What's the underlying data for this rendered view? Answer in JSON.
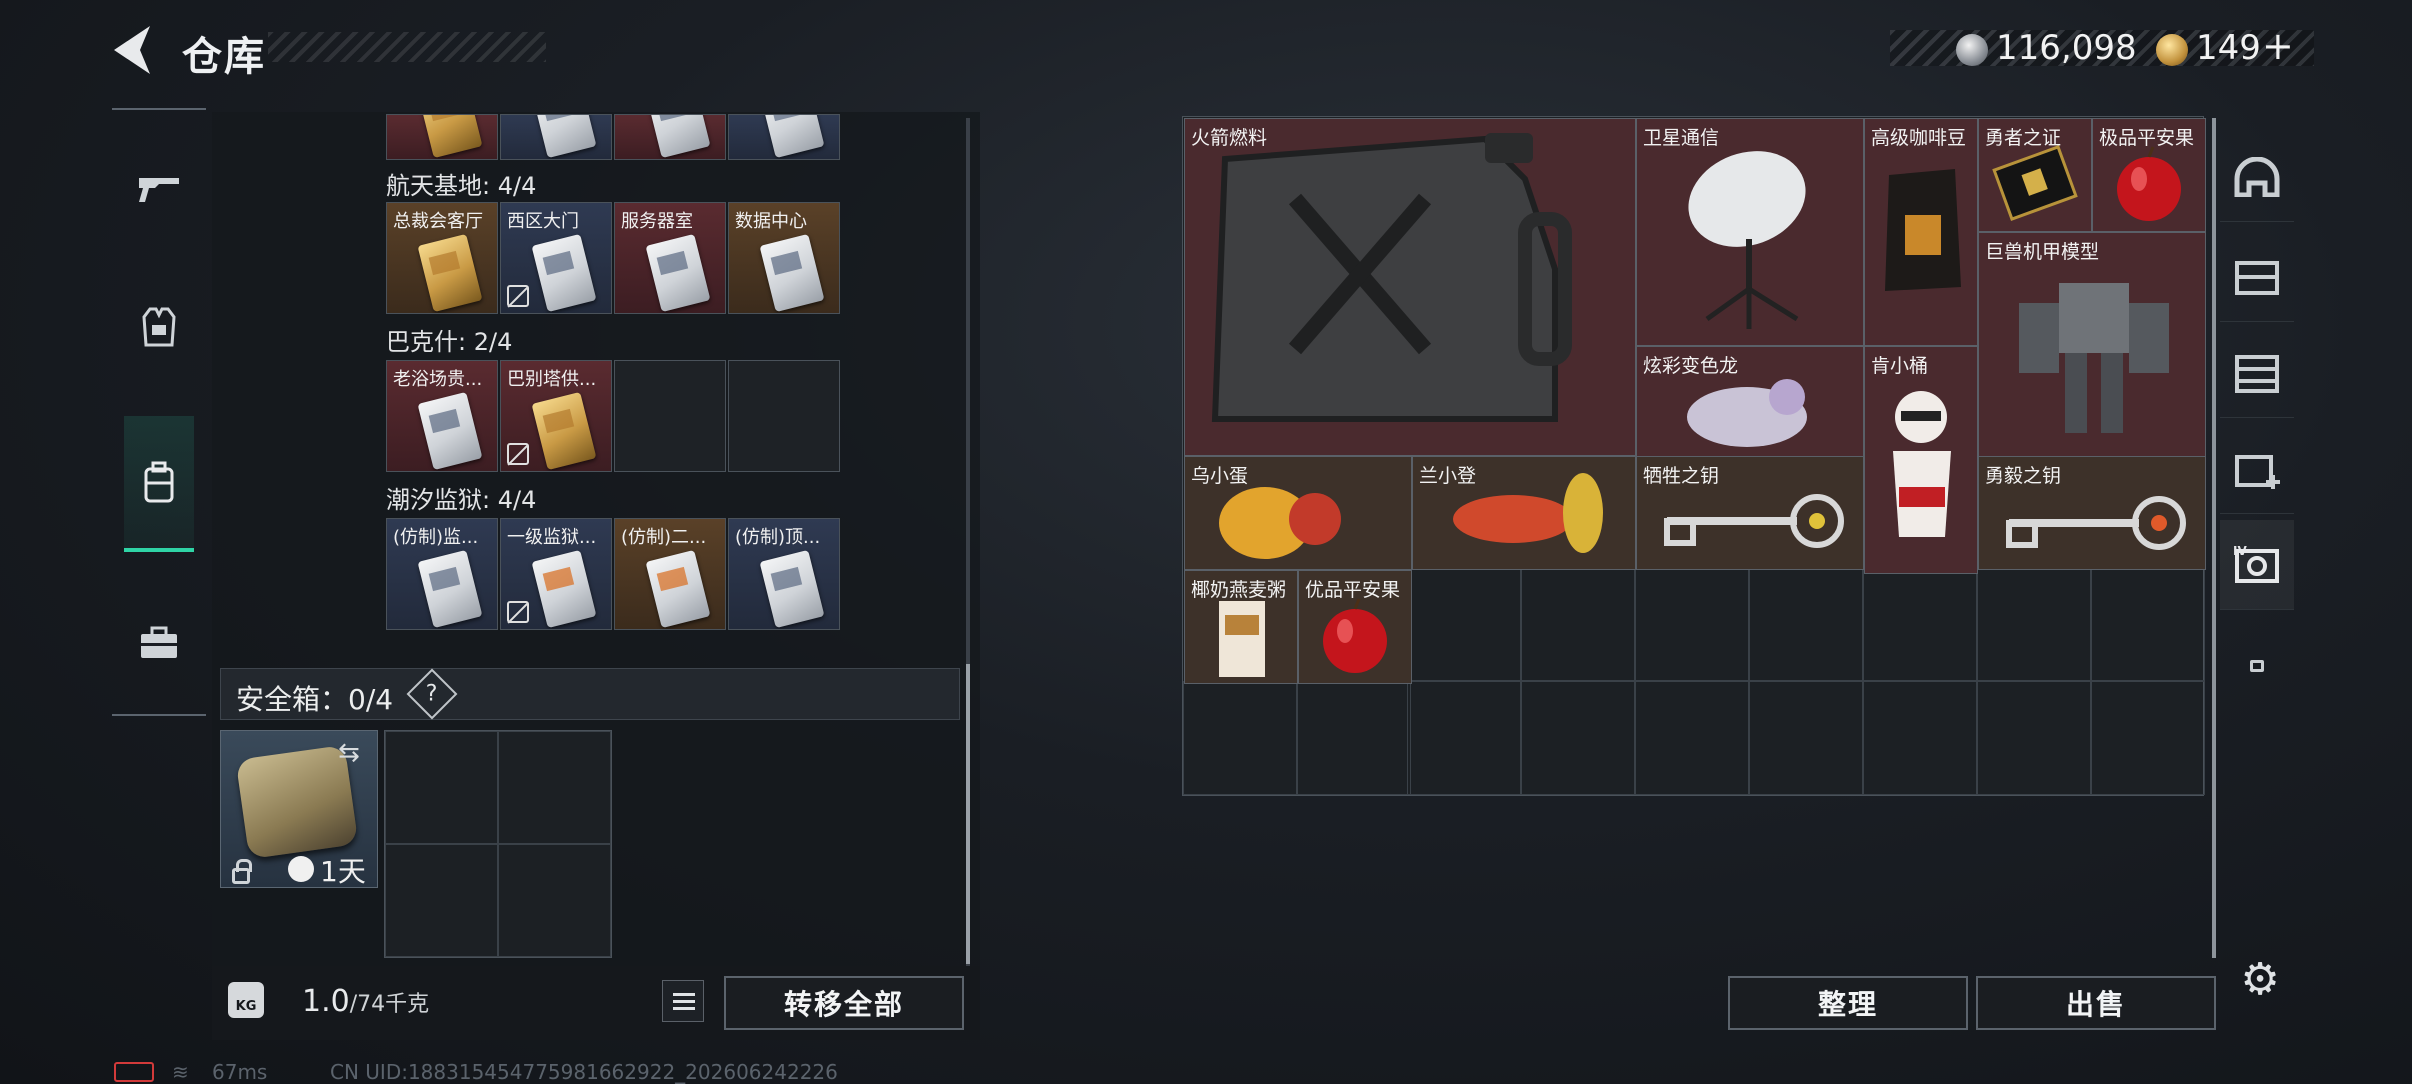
{
  "header": {
    "title": "仓库"
  },
  "currency": {
    "silver": "116,098",
    "gold": "149",
    "gold_add": "+"
  },
  "left_nav": [
    "gun-icon",
    "vest-icon",
    "backpack-icon",
    "toolbox-icon"
  ],
  "key_sections": [
    {
      "label": "航天基地: 4/4",
      "items": [
        "总裁会客厅",
        "西区大门",
        "服务器室",
        "数据中心"
      ]
    },
    {
      "label": "巴克什: 2/4",
      "items": [
        "老浴场贵...",
        "巴别塔供..."
      ]
    },
    {
      "label": "潮汐监狱: 4/4",
      "items": [
        "(仿制)监...",
        "一级监狱...",
        "(仿制)二...",
        "(仿制)顶..."
      ]
    }
  ],
  "safe": {
    "label": "安全箱：0/4",
    "help": "?",
    "duration": "1天"
  },
  "weight": {
    "current": "1.0",
    "capacity": "/74千克",
    "icon_text": "KG"
  },
  "buttons": {
    "transfer_all": "转移全部",
    "tidy": "整理",
    "sell": "出售"
  },
  "stash_items": {
    "rocket_fuel": "火箭燃料",
    "satellite": "卫星通信",
    "coffee": "高级咖啡豆",
    "brave_badge": "勇者之证",
    "apple_top": "极品平安果",
    "mech_model": "巨兽机甲模型",
    "toy": "炫彩变色龙",
    "kfc": "肯小桶",
    "egg": "乌小蛋",
    "lan": "兰小登",
    "key_sacrifice": "牺牲之钥",
    "key_brave": "勇毅之钥",
    "cereal": "椰奶燕麦粥",
    "apple_good": "优品平安果"
  },
  "right_nav": [
    "helmet-icon",
    "rack-icon",
    "shelf-icon",
    "medkit-icon",
    "stash-level-icon",
    "lock-icon"
  ],
  "footer": {
    "ping": "67ms",
    "uid": "CN UID:18831545477598166292​2_202606242226"
  }
}
